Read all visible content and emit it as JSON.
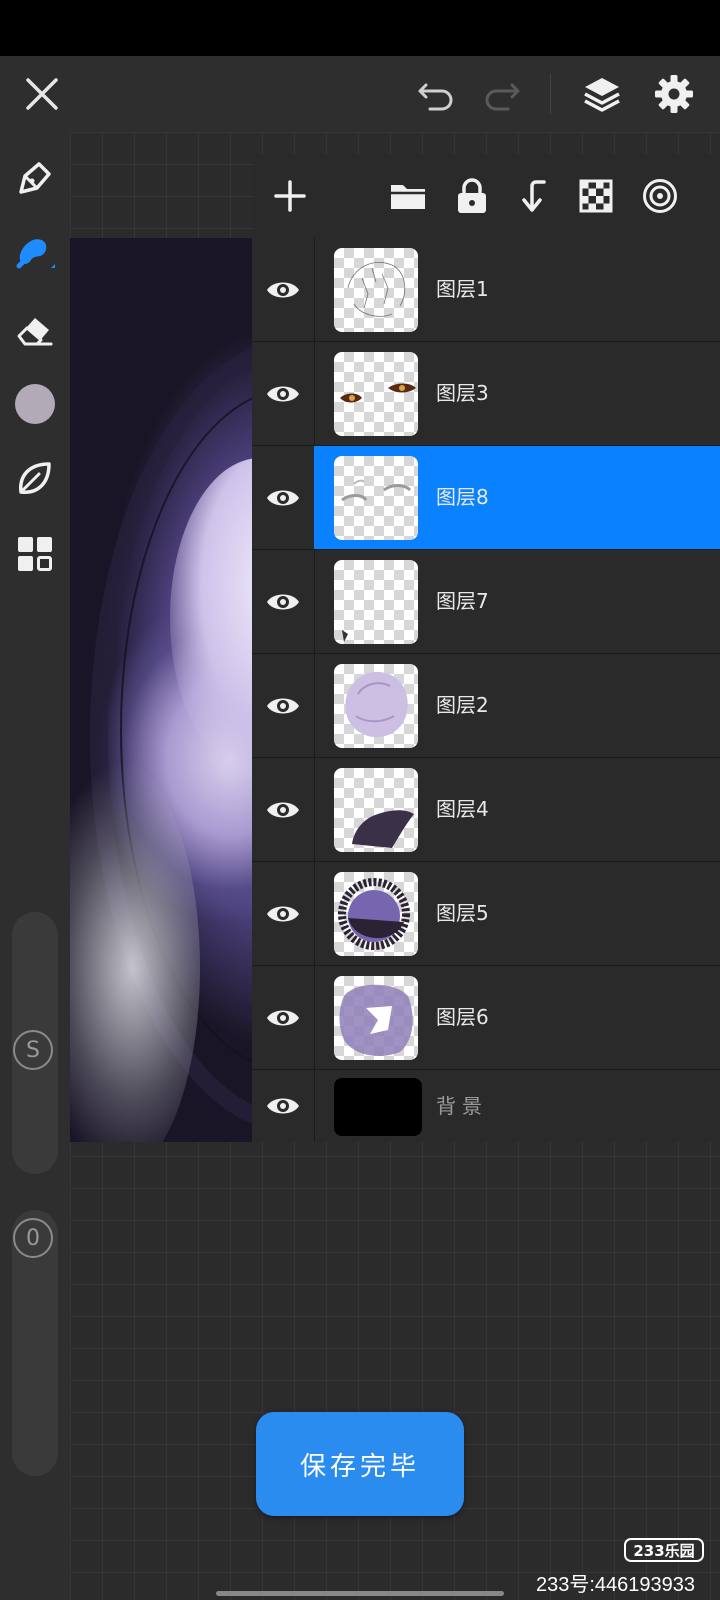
{
  "app": {
    "toolbar": {
      "close_icon": "close-icon",
      "undo_icon": "undo-icon",
      "redo_icon": "redo-icon",
      "layers_icon": "layers-icon",
      "settings_icon": "gear-icon"
    },
    "tools": [
      {
        "name": "pen-tool",
        "icon": "pen-icon"
      },
      {
        "name": "brush-tool",
        "icon": "brush-icon",
        "active": true
      },
      {
        "name": "eraser-tool",
        "icon": "eraser-icon"
      },
      {
        "name": "color-swatch",
        "color": "#b3aab8"
      },
      {
        "name": "leaf-tool",
        "icon": "leaf-icon"
      },
      {
        "name": "grid-tool",
        "icon": "grid-icon"
      }
    ],
    "sliders": {
      "size_label": "S",
      "opacity_label": "0"
    },
    "layers_panel": {
      "toolbar_icons": [
        "add-icon",
        "folder-icon",
        "lock-icon",
        "merge-down-icon",
        "checker-icon",
        "target-icon"
      ],
      "layers": [
        {
          "name": "图层1",
          "selected": false
        },
        {
          "name": "图层3",
          "selected": false
        },
        {
          "name": "图层8",
          "selected": true
        },
        {
          "name": "图层7",
          "selected": false
        },
        {
          "name": "图层2",
          "selected": false
        },
        {
          "name": "图层4",
          "selected": false
        },
        {
          "name": "图层5",
          "selected": false
        },
        {
          "name": "图层6",
          "selected": false
        }
      ],
      "background_layer": {
        "name": "背景"
      }
    },
    "save_button": "保存完毕",
    "accent_color": "#0a82ff"
  },
  "watermark": {
    "badge": "233乐园",
    "text": "233号:446193933"
  }
}
